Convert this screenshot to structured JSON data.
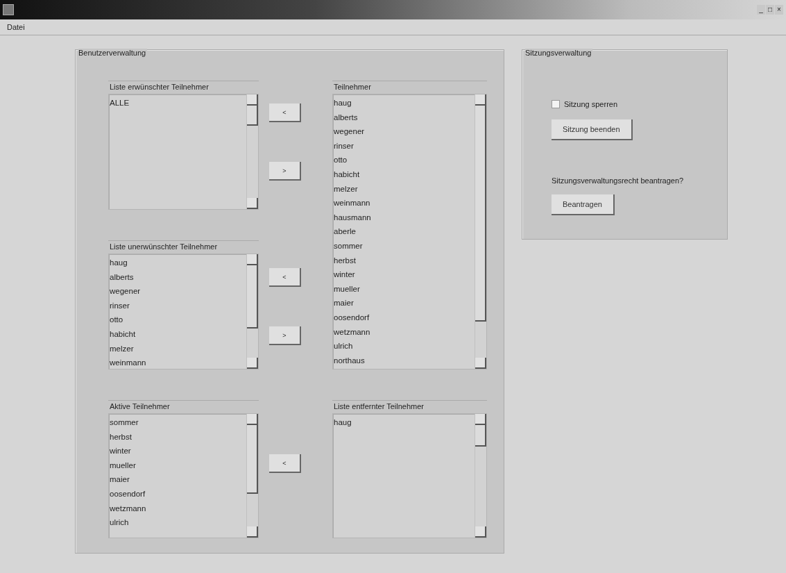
{
  "window": {
    "controls": [
      "_",
      "□",
      "×"
    ]
  },
  "menu": [
    "Datei"
  ],
  "user_panel": {
    "title": "Benutzerverwaltung",
    "lists": [
      {
        "title": "Liste erwünschter Teilnehmer",
        "items": [
          "ALLE"
        ]
      },
      {
        "title": "Liste unerwünschter Teilnehmer",
        "items": [
          "haug",
          "alberts",
          "wegener",
          "rinser",
          "otto",
          "habicht",
          "melzer",
          "weinmann"
        ]
      },
      {
        "title": "Aktive Teilnehmer",
        "items": [
          "sommer",
          "herbst",
          "winter",
          "mueller",
          "maier",
          "oosendorf",
          "wetzmann",
          "ulrich"
        ]
      },
      {
        "title": "Teilnehmer",
        "items": [
          "haug",
          "alberts",
          "wegener",
          "rinser",
          "otto",
          "habicht",
          "melzer",
          "weinmann",
          "hausmann",
          "aberle",
          "sommer",
          "herbst",
          "winter",
          "mueller",
          "maier",
          "oosendorf",
          "wetzmann",
          "ulrich",
          "northaus"
        ]
      },
      {
        "title": "Liste entfernter Teilnehmer",
        "items": [
          "haug"
        ]
      }
    ],
    "move_buttons": [
      "<",
      ">",
      "<",
      ">",
      "<"
    ]
  },
  "session_panel": {
    "title": "Sitzungsverwaltung",
    "lock": {
      "label": "Sitzung sperren",
      "checked": false
    },
    "end_button": "Sitzung beenden",
    "question": "Sitzungsverwaltungsrecht beantragen?",
    "request_button": "Beantragen"
  }
}
